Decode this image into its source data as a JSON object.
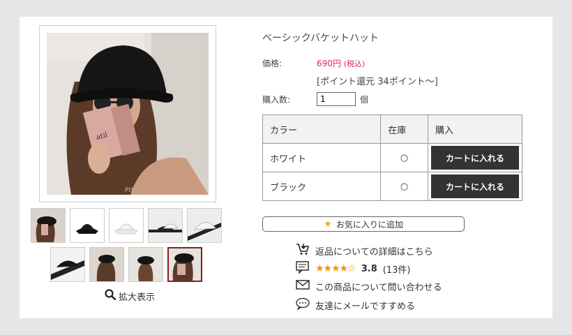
{
  "product": {
    "title": "ベーシックバケットハット",
    "price_label": "価格:",
    "price": "690円",
    "tax": "(税込)",
    "points": "[ポイント還元 34ポイント〜]",
    "qty_label": "購入数:",
    "qty_value": "1",
    "qty_unit": "個"
  },
  "table": {
    "headers": [
      "カラー",
      "在庫",
      "購入"
    ],
    "rows": [
      {
        "color": "ホワイト",
        "stock": "○",
        "button": "カートに入れる"
      },
      {
        "color": "ブラック",
        "stock": "○",
        "button": "カートに入れる"
      }
    ]
  },
  "favorite_label": "お気に入りに追加",
  "links": {
    "returns": "返品についての詳細はこちら",
    "rating_value": "3.8",
    "rating_count": "(13件)",
    "rating_stars": 3.8,
    "inquiry": "この商品について問い合わせる",
    "recommend": "友達にメールですすめる"
  },
  "gallery": {
    "zoom_label": "拡大表示",
    "main_watermark": "PIS"
  },
  "colors": {
    "price": "#e0206a",
    "button": "#333333",
    "star": "#f29400",
    "active_thumb_border": "#8b1d1d"
  }
}
